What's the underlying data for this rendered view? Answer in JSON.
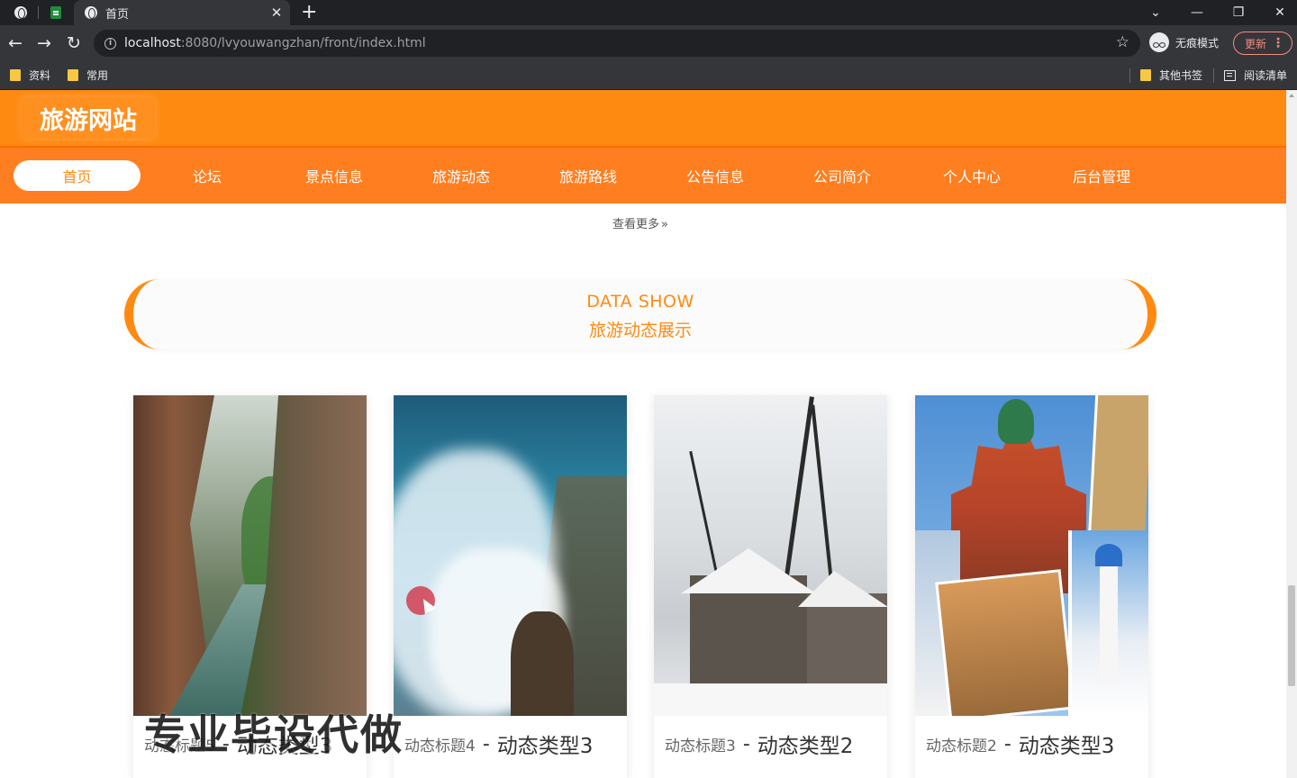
{
  "browser": {
    "tab_title": "首页",
    "new_tab_symbol": "+",
    "close_symbol": "✕",
    "url_host": "localhost",
    "url_rest": ":8080/lvyouwangzhan/front/index.html",
    "incognito_label": "无痕模式",
    "update_label": "更新",
    "more_symbol": "⋮",
    "bookmarks": [
      {
        "label": "资料"
      },
      {
        "label": "常用"
      }
    ],
    "bookmarks_right": [
      {
        "label": "其他书签"
      },
      {
        "label": "阅读清单"
      }
    ],
    "window_controls": {
      "chevron": "⌄",
      "minimize": "—",
      "restore": "❐",
      "close": "✕"
    }
  },
  "site": {
    "logo": "旅游网站",
    "brand_color": "#ff8a12",
    "nav": [
      {
        "label": "首页",
        "active": true
      },
      {
        "label": "论坛"
      },
      {
        "label": "景点信息"
      },
      {
        "label": "旅游动态"
      },
      {
        "label": "旅游路线"
      },
      {
        "label": "公告信息"
      },
      {
        "label": "公司简介"
      },
      {
        "label": "个人中心"
      },
      {
        "label": "后台管理"
      }
    ],
    "see_more": "查看更多",
    "see_more_icon": "»",
    "section": {
      "title_en": "DATA SHOW",
      "title_zh": "旅游动态展示"
    },
    "cards": [
      {
        "title": "动态标题5",
        "dash": "-",
        "type": "动态类型3",
        "image": "canyon-photo"
      },
      {
        "title": "动态标题4",
        "dash": "-",
        "type": "动态类型3",
        "image": "waterfall-photo"
      },
      {
        "title": "动态标题3",
        "dash": "-",
        "type": "动态类型2",
        "image": "snow-village-photo"
      },
      {
        "title": "动态标题2",
        "dash": "-",
        "type": "动态类型3",
        "image": "travel-collage-photo"
      }
    ],
    "watermark": "专业毕设代做"
  }
}
